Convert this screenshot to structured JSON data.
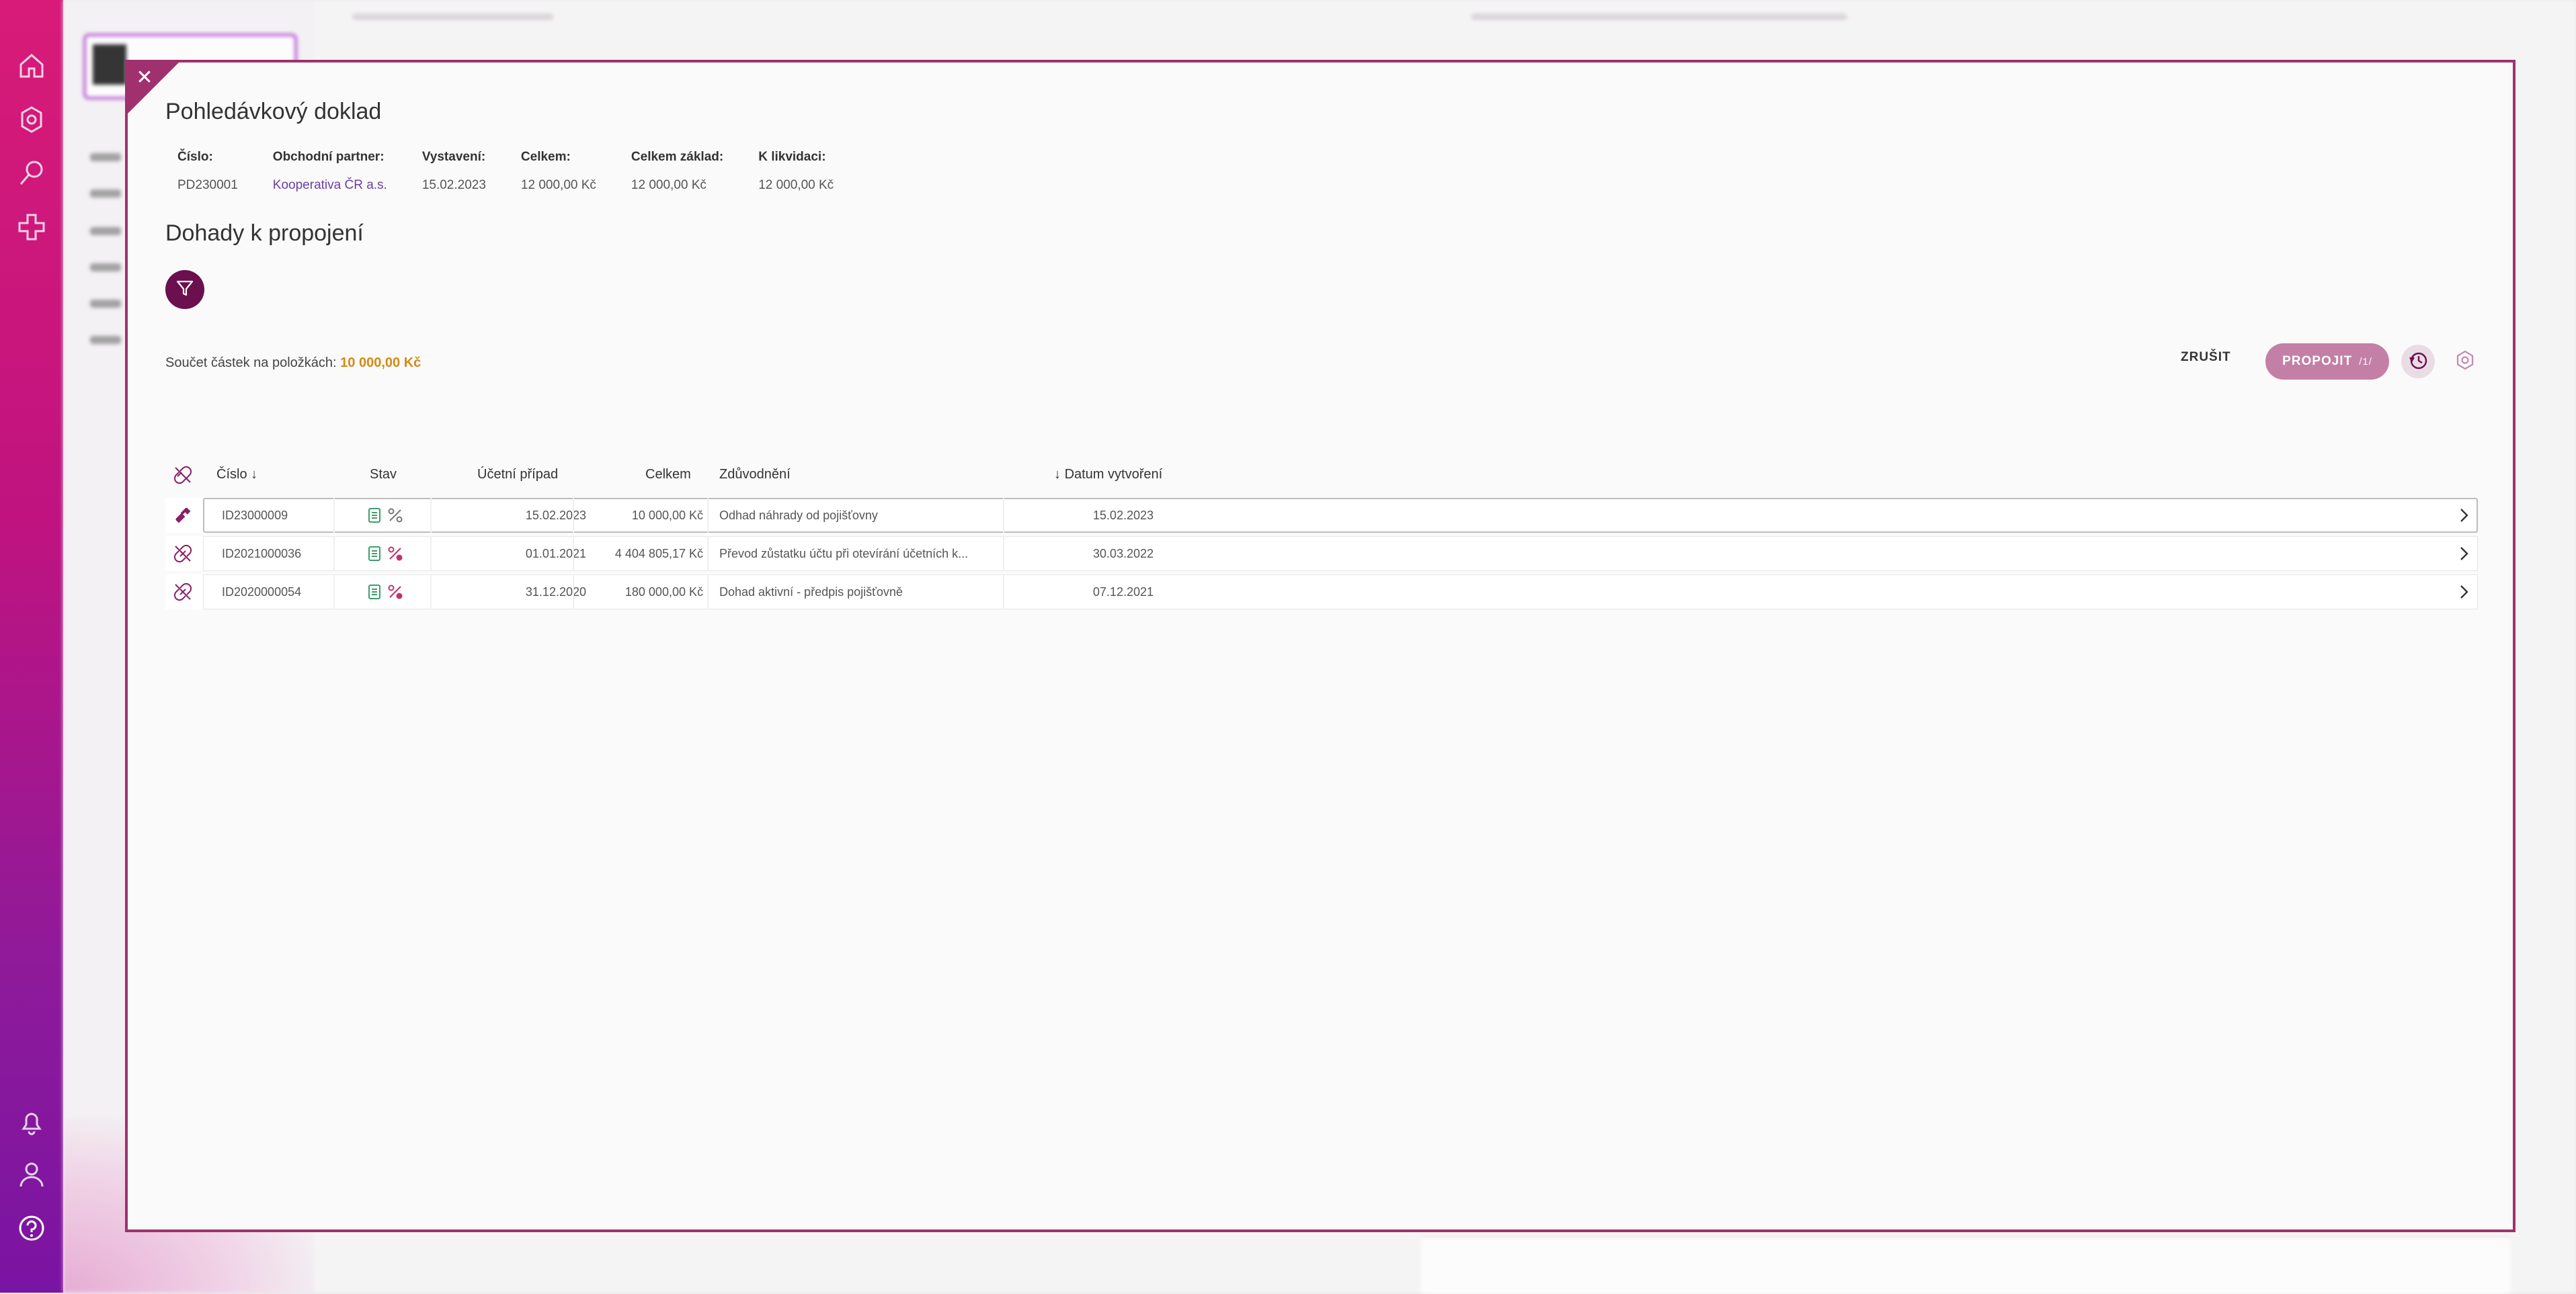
{
  "modal": {
    "title": "Pohledávkový doklad",
    "close_label": "✕",
    "info": [
      {
        "label": "Číslo:",
        "value": "PD230001"
      },
      {
        "label": "Obchodní partner:",
        "value": "Kooperativa ČR a.s."
      },
      {
        "label": "Vystavení:",
        "value": "15.02.2023"
      },
      {
        "label": "Celkem:",
        "value": "12 000,00 Kč"
      },
      {
        "label": "Celkem základ:",
        "value": "12 000,00 Kč"
      },
      {
        "label": "K likvidaci:",
        "value": "12 000,00 Kč"
      }
    ],
    "section_title": "Dohady k propojení",
    "sum_label": "Součet částek na položkách:",
    "sum_value": "10 000,00 Kč",
    "cancel_label": "ZRUŠIT",
    "link_label": "PROPOJIT",
    "link_count": "/1/"
  },
  "table": {
    "headers": {
      "cislo": "Číslo",
      "stav": "Stav",
      "ucetni_pripad": "Účetní případ",
      "celkem": "Celkem",
      "zduvodneni": "Zdůvodnění",
      "datum": "Datum vytvoření"
    },
    "rows": [
      {
        "cislo": "ID23000009",
        "ucetni_pripad": "15.02.2023",
        "celkem": "10 000,00 Kč",
        "zduvodneni": "Odhad náhrady od pojišťovny",
        "datum": "15.02.2023",
        "selected": true
      },
      {
        "cislo": "ID2021000036",
        "ucetni_pripad": "01.01.2021",
        "celkem": "4 404 805,17 Kč",
        "zduvodneni": "Převod zůstatku účtu při otevírání účetních k...",
        "datum": "30.03.2022",
        "selected": false
      },
      {
        "cislo": "ID2020000054",
        "ucetni_pripad": "31.12.2020",
        "celkem": "180 000,00 Kč",
        "zduvodneni": "Dohad aktivní - předpis pojišťovně",
        "datum": "07.12.2021",
        "selected": false
      }
    ]
  },
  "colors": {
    "rail_top": "#d81b78",
    "rail_bottom": "#7a14a2",
    "accent": "#a0306e",
    "sum_value": "#d58a13",
    "propojit": "#c47fa6"
  }
}
